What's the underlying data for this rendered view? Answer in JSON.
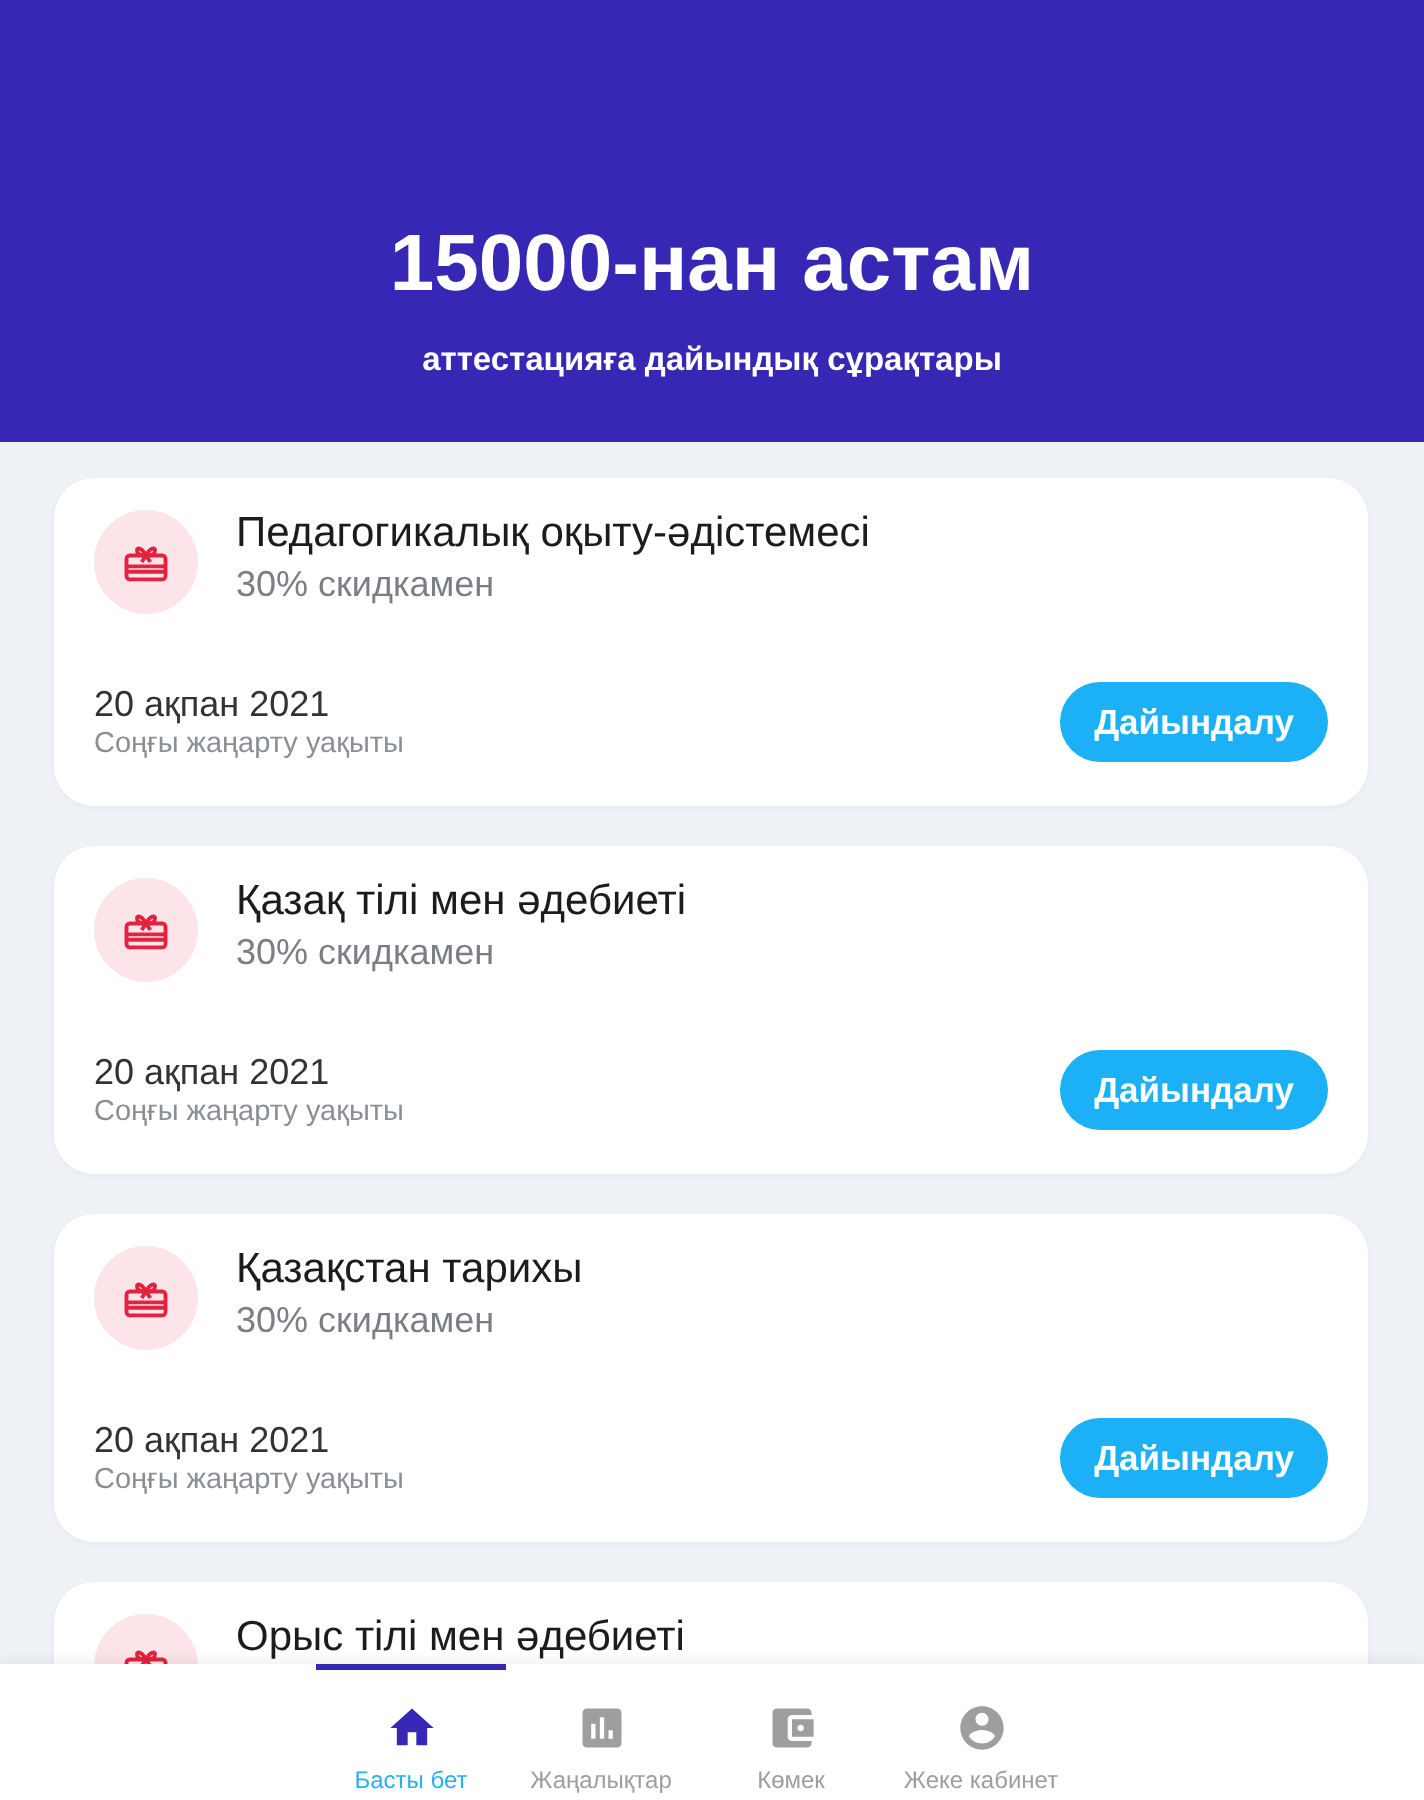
{
  "header": {
    "title": "15000-нан астам",
    "subtitle": "аттестацияға дайындық сұрақтары"
  },
  "courses": [
    {
      "title": "Педагогикалық оқыту-әдістемесі",
      "discount": "30% скидкамен",
      "date": "20 ақпан 2021",
      "date_caption": "Соңғы жаңарту уақыты",
      "button": "Дайындалу"
    },
    {
      "title": "Қазақ тілі мен әдебиеті",
      "discount": "30% скидкамен",
      "date": "20 ақпан 2021",
      "date_caption": "Соңғы жаңарту уақыты",
      "button": "Дайындалу"
    },
    {
      "title": "Қазақстан тарихы",
      "discount": "30% скидкамен",
      "date": "20 ақпан 2021",
      "date_caption": "Соңғы жаңарту уақыты",
      "button": "Дайындалу"
    },
    {
      "title": "Орыс тілі мен әдебиеті"
    }
  ],
  "bottom_nav": [
    {
      "label": "Басты бет",
      "selected": true
    },
    {
      "label": "Жаңалықтар",
      "selected": false
    },
    {
      "label": "Көмек",
      "selected": false
    },
    {
      "label": "Жеке кабинет",
      "selected": false
    }
  ]
}
